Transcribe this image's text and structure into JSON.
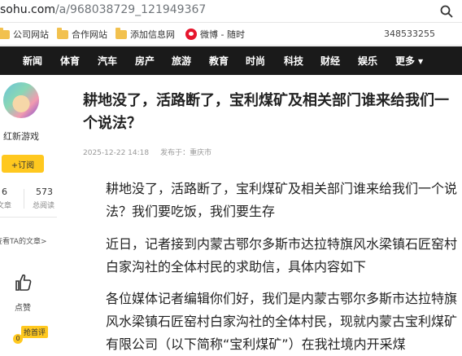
{
  "browser": {
    "url_host": "sohu.com",
    "url_path": "/a/968038729_121949367"
  },
  "bookmarks": {
    "items": [
      "公司网站",
      "合作网站",
      "添加信息网",
      "微博 - 随时"
    ],
    "number": "348533255"
  },
  "nav": {
    "items": [
      "新闻",
      "体育",
      "汽车",
      "房产",
      "旅游",
      "教育",
      "时尚",
      "科技",
      "财经",
      "娱乐"
    ],
    "more": "更多"
  },
  "sidebar": {
    "author": "红新游戏",
    "follow": "+订阅",
    "stats": [
      {
        "value": "6",
        "label": "文章"
      },
      {
        "value": "573",
        "label": "总阅读"
      }
    ],
    "ta_link": "查看TA的文章>",
    "like_label": "点赞",
    "comment_badge": "抢首评",
    "comment_num": "0"
  },
  "article": {
    "title": "耕地没了，活路断了，宝利煤矿及相关部门谁来给我们一个说法？",
    "date": "2025-12-22 14:18",
    "source": "发布于：重庆市",
    "paragraphs": [
      "耕地没了，活路断了，宝利煤矿及相关部门谁来给我们一个说法？我们要吃饭，我们要生存",
      "近日，记者接到内蒙古鄂尔多斯市达拉特旗风水梁镇石匠窑村白家沟社的全体村民的求助信，具体内容如下",
      "各位媒体记者编辑你们好，我们是内蒙古鄂尔多斯市达拉特旗风水梁镇石匠窑村白家沟社的全体村民，现就内蒙古宝利煤矿有限公司（以下简称“宝利煤矿”）在我社境内开采煤"
    ]
  },
  "colors": {
    "nav_bg": "#1a1a1a",
    "accent_yellow": "#ffc81f"
  },
  "icons": [
    "zoom-icon",
    "folder-icon",
    "weibo-icon",
    "thumbs-up-icon",
    "comment-icon"
  ]
}
